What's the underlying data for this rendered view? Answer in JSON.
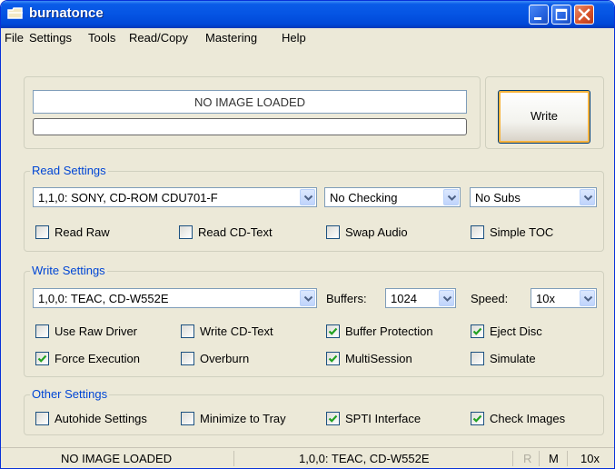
{
  "window": {
    "title": "burnatonce"
  },
  "menu": {
    "items": [
      "File",
      "Settings",
      "Tools",
      "Read/Copy",
      "Mastering",
      "Help"
    ]
  },
  "image": {
    "status": "NO IMAGE LOADED",
    "progress": 0
  },
  "write_button": {
    "label": "Write"
  },
  "read_settings": {
    "label": "Read Settings",
    "drive": "1,1,0: SONY, CD-ROM CDU701-F",
    "checking": "No Checking",
    "subs": "No Subs",
    "options": [
      {
        "label": "Read Raw",
        "checked": false
      },
      {
        "label": "Read CD-Text",
        "checked": false
      },
      {
        "label": "Swap Audio",
        "checked": false
      },
      {
        "label": "Simple TOC",
        "checked": false
      }
    ]
  },
  "write_settings": {
    "label": "Write Settings",
    "drive": "1,0,0: TEAC, CD-W552E",
    "buffers_label": "Buffers:",
    "buffers": "1024",
    "speed_label": "Speed:",
    "speed": "10x",
    "options": [
      {
        "label": "Use Raw Driver",
        "checked": false
      },
      {
        "label": "Write CD-Text",
        "checked": false
      },
      {
        "label": "Buffer Protection",
        "checked": true
      },
      {
        "label": "Eject Disc",
        "checked": true
      },
      {
        "label": "Force Execution",
        "checked": true
      },
      {
        "label": "Overburn",
        "checked": false
      },
      {
        "label": "MultiSession",
        "checked": true
      },
      {
        "label": "Simulate",
        "checked": false
      }
    ]
  },
  "other_settings": {
    "label": "Other Settings",
    "options": [
      {
        "label": "Autohide Settings",
        "checked": false
      },
      {
        "label": "Minimize to Tray",
        "checked": false
      },
      {
        "label": "SPTI Interface",
        "checked": true
      },
      {
        "label": "Check Images",
        "checked": true
      }
    ]
  },
  "statusbar": {
    "image": "NO IMAGE LOADED",
    "drive": "1,0,0: TEAC, CD-W552E",
    "r": "R",
    "m": "M",
    "speed": "10x"
  },
  "colors": {
    "title_bar": "#0554E3",
    "group_label": "#0046D5",
    "check_mark": "#21A121",
    "write_focus": "#F8B33C"
  },
  "icons": {
    "app": "app-folder-icon",
    "minimize": "minimize-icon",
    "maximize": "maximize-icon",
    "close": "close-icon",
    "dropdown": "chevron-down-icon",
    "check": "checkmark-icon"
  }
}
